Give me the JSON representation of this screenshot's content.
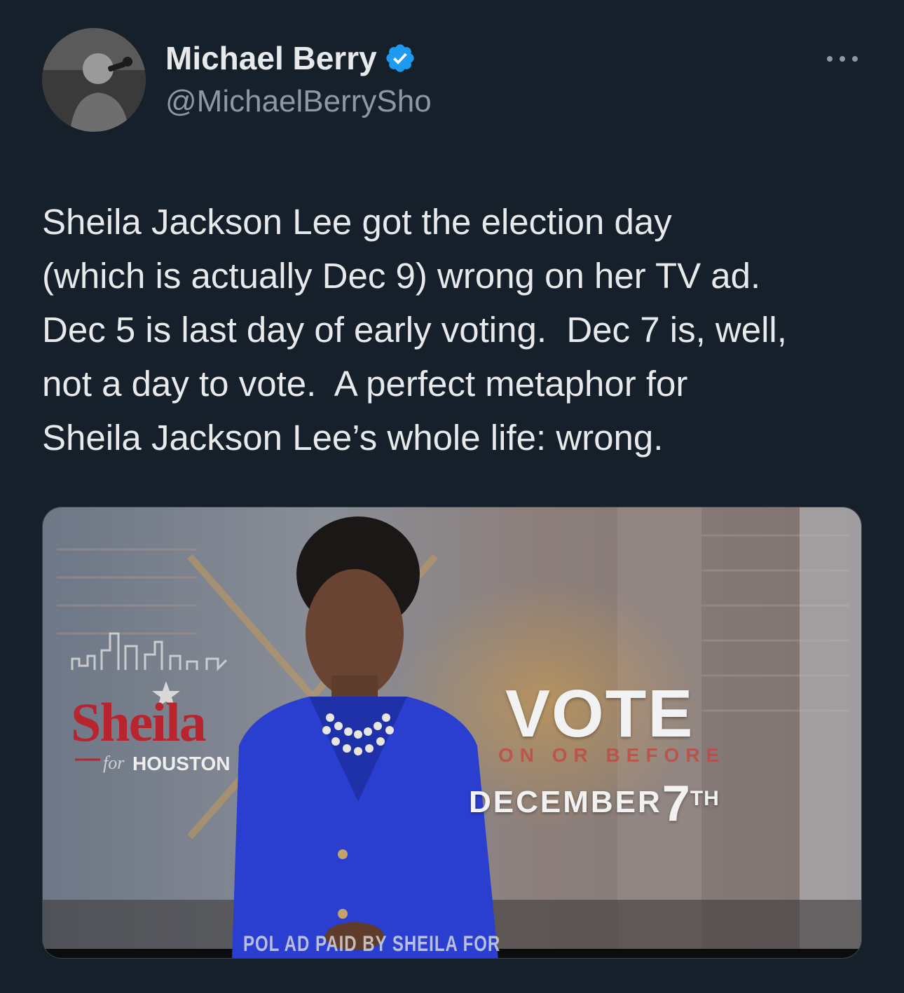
{
  "author": {
    "display_name": "Michael Berry",
    "handle": "@MichaelBerrySho",
    "avatar_icon": "avatar-photo",
    "verified_icon": "verified-badge-icon"
  },
  "more_icon": "more-options-icon",
  "tweet": {
    "text": "Sheila Jackson Lee got the election day\n(which is actually Dec 9) wrong on her TV ad.\nDec 5 is last day of early voting.  Dec 7 is, well,\nnot a day to vote.  A perfect metaphor for\nSheila Jackson Lee’s whole life: wrong."
  },
  "media": {
    "logo_name": "Sheila",
    "logo_for": "for",
    "logo_city": "HOUSTON",
    "vote_label": "VOTE",
    "vote_sub": "ON OR BEFORE",
    "vote_month": "DECEMBER",
    "vote_day": "7",
    "vote_suffix": "TH",
    "disclaimer": "POL AD PAID BY SHEILA FOR"
  },
  "colors": {
    "background": "#15202b",
    "text_primary": "#e7e9ea",
    "text_secondary": "#8b98a5",
    "verified_blue": "#1d9bf0",
    "blazer_blue": "#2a3fd0",
    "logo_red": "#b8252f"
  }
}
